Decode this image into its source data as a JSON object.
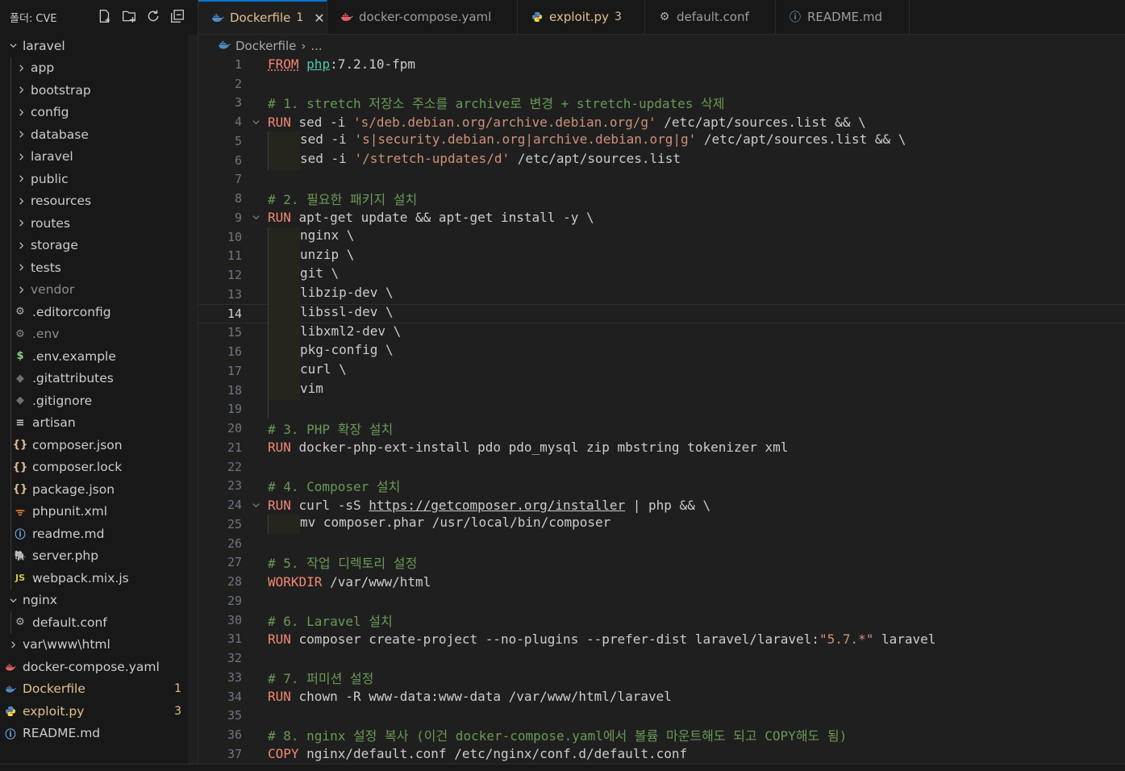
{
  "sidebar": {
    "title": "폴더: CVE",
    "actions": [
      {
        "name": "new-file-icon"
      },
      {
        "name": "new-folder-icon"
      },
      {
        "name": "refresh-icon"
      },
      {
        "name": "collapse-all-icon"
      }
    ],
    "items": [
      {
        "label": "laravel",
        "kind": "folder-open",
        "level": 0
      },
      {
        "label": "app",
        "kind": "folder",
        "level": 1
      },
      {
        "label": "bootstrap",
        "kind": "folder",
        "level": 1
      },
      {
        "label": "config",
        "kind": "folder",
        "level": 1
      },
      {
        "label": "database",
        "kind": "folder",
        "level": 1
      },
      {
        "label": "laravel",
        "kind": "folder",
        "level": 1
      },
      {
        "label": "public",
        "kind": "folder",
        "level": 1
      },
      {
        "label": "resources",
        "kind": "folder",
        "level": 1
      },
      {
        "label": "routes",
        "kind": "folder",
        "level": 1
      },
      {
        "label": "storage",
        "kind": "folder",
        "level": 1
      },
      {
        "label": "tests",
        "kind": "folder",
        "level": 1
      },
      {
        "label": "vendor",
        "kind": "folder",
        "level": 1,
        "dim": true
      },
      {
        "label": ".editorconfig",
        "kind": "file",
        "level": 1,
        "icon": "gear-icon",
        "glyph": "⚙",
        "color": "#b0b0b0"
      },
      {
        "label": ".env",
        "kind": "file",
        "level": 1,
        "icon": "gear-icon",
        "glyph": "⚙",
        "color": "#8c8c8c",
        "dim": true
      },
      {
        "label": ".env.example",
        "kind": "file",
        "level": 1,
        "icon": "dollar-icon",
        "glyph": "$",
        "color": "#89d185"
      },
      {
        "label": ".gitattributes",
        "kind": "file",
        "level": 1,
        "icon": "git-icon",
        "glyph": "◆",
        "color": "#6e6e6e"
      },
      {
        "label": ".gitignore",
        "kind": "file",
        "level": 1,
        "icon": "git-icon",
        "glyph": "◆",
        "color": "#6e6e6e"
      },
      {
        "label": "artisan",
        "kind": "file",
        "level": 1,
        "icon": "lines-icon",
        "glyph": "≡",
        "color": "#cccccc"
      },
      {
        "label": "composer.json",
        "kind": "file",
        "level": 1,
        "icon": "json-braces-icon",
        "glyph": "{}",
        "color": "#e2c08d"
      },
      {
        "label": "composer.lock",
        "kind": "file",
        "level": 1,
        "icon": "json-braces-icon",
        "glyph": "{}",
        "color": "#e2c08d"
      },
      {
        "label": "package.json",
        "kind": "file",
        "level": 1,
        "icon": "json-braces-icon",
        "glyph": "{}",
        "color": "#e2c08d"
      },
      {
        "label": "phpunit.xml",
        "kind": "file",
        "level": 1,
        "icon": "rss-icon",
        "glyph": "ᯤ",
        "color": "#e37933"
      },
      {
        "label": "readme.md",
        "kind": "file",
        "level": 1,
        "icon": "info-icon",
        "glyph": "ⓘ",
        "color": "#75beff"
      },
      {
        "label": "server.php",
        "kind": "file",
        "level": 1,
        "icon": "php-elephant-icon",
        "glyph": "🐘",
        "color": "#a074c4"
      },
      {
        "label": "webpack.mix.js",
        "kind": "file",
        "level": 1,
        "icon": "js-icon",
        "glyph": "JS",
        "color": "#cbcb41"
      },
      {
        "label": "nginx",
        "kind": "folder-open",
        "level": 0
      },
      {
        "label": "default.conf",
        "kind": "file",
        "level": 1,
        "icon": "gear-icon",
        "glyph": "⚙",
        "color": "#b0b0b0"
      },
      {
        "label": "var\\www\\html",
        "kind": "folder",
        "level": 0
      },
      {
        "label": "docker-compose.yaml",
        "kind": "file",
        "level": 0,
        "icon": "docker-compose-icon",
        "glyph": "🐳",
        "color": "#e25f6a"
      },
      {
        "label": "Dockerfile",
        "kind": "file",
        "level": 0,
        "icon": "docker-icon",
        "glyph": "🐳",
        "color": "#4f8cc9",
        "modified": true,
        "badge": "1"
      },
      {
        "label": "exploit.py",
        "kind": "file",
        "level": 0,
        "icon": "python-icon",
        "glyph": "🐍",
        "color": "#4f8cc9",
        "modified": true,
        "badge": "3"
      },
      {
        "label": "README.md",
        "kind": "file",
        "level": 0,
        "icon": "info-icon",
        "glyph": "ⓘ",
        "color": "#75beff"
      }
    ]
  },
  "tabs": [
    {
      "label": "Dockerfile",
      "count": "1",
      "icon": "docker-icon",
      "color": "#4f8cc9",
      "active": true,
      "close": "✕"
    },
    {
      "label": "docker-compose.yaml",
      "count": "",
      "icon": "docker-compose-icon",
      "color": "#e25f6a",
      "active": false
    },
    {
      "label": "exploit.py",
      "count": "3",
      "icon": "python-icon",
      "color": "#4f8cc9",
      "active": false,
      "modified": true
    },
    {
      "label": "default.conf",
      "count": "",
      "icon": "gear-icon",
      "color": "#b0b0b0",
      "active": false
    },
    {
      "label": "README.md",
      "count": "",
      "icon": "info-icon",
      "color": "#75beff",
      "active": false
    }
  ],
  "breadcrumb": {
    "file": "Dockerfile",
    "rest": "..."
  },
  "editor": {
    "current_line": 14,
    "lines": [
      {
        "n": 1,
        "t": [
          {
            "c": "from",
            "s": "FROM"
          },
          {
            "s": " "
          },
          {
            "c": "img",
            "s": "php"
          },
          {
            "s": ":7.2.10-fpm"
          }
        ]
      },
      {
        "n": 2,
        "t": []
      },
      {
        "n": 3,
        "t": [
          {
            "c": "cmt",
            "s": "# 1. stretch 저장소 주소를 archive로 변경 + stretch-updates 삭제"
          }
        ]
      },
      {
        "n": 4,
        "fold": true,
        "t": [
          {
            "c": "dkw",
            "s": "RUN"
          },
          {
            "s": " sed -i "
          },
          {
            "c": "str",
            "s": "'s/deb.debian.org/archive.debian.org/g'"
          },
          {
            "s": " /etc/apt/sources.list && \\"
          }
        ]
      },
      {
        "n": 5,
        "ind": 1,
        "t": [
          {
            "s": "sed -i "
          },
          {
            "c": "str",
            "s": "'s|security.debian.org|archive.debian.org|g'"
          },
          {
            "s": " /etc/apt/sources.list && \\"
          }
        ]
      },
      {
        "n": 6,
        "ind": 1,
        "t": [
          {
            "s": "sed -i "
          },
          {
            "c": "str",
            "s": "'/stretch-updates/d'"
          },
          {
            "s": " /etc/apt/sources.list"
          }
        ]
      },
      {
        "n": 7,
        "t": []
      },
      {
        "n": 8,
        "t": [
          {
            "c": "cmt",
            "s": "# 2. 필요한 패키지 설치"
          }
        ]
      },
      {
        "n": 9,
        "fold": true,
        "t": [
          {
            "c": "dkw",
            "s": "RUN"
          },
          {
            "s": " apt-get update && apt-get install -y \\"
          }
        ]
      },
      {
        "n": 10,
        "ind": 1,
        "t": [
          {
            "s": "nginx \\"
          }
        ]
      },
      {
        "n": 11,
        "ind": 1,
        "t": [
          {
            "s": "unzip \\"
          }
        ]
      },
      {
        "n": 12,
        "ind": 1,
        "t": [
          {
            "s": "git \\"
          }
        ]
      },
      {
        "n": 13,
        "ind": 1,
        "t": [
          {
            "s": "libzip-dev \\"
          }
        ]
      },
      {
        "n": 14,
        "ind": 1,
        "t": [
          {
            "s": "libssl-dev \\"
          }
        ]
      },
      {
        "n": 15,
        "ind": 1,
        "t": [
          {
            "s": "libxml2-dev \\"
          }
        ]
      },
      {
        "n": 16,
        "ind": 1,
        "t": [
          {
            "s": "pkg-config \\"
          }
        ]
      },
      {
        "n": 17,
        "ind": 1,
        "t": [
          {
            "s": "curl \\"
          }
        ]
      },
      {
        "n": 18,
        "ind": 1,
        "t": [
          {
            "s": "vim"
          }
        ]
      },
      {
        "n": 19,
        "guide": true,
        "t": []
      },
      {
        "n": 20,
        "t": [
          {
            "c": "cmt",
            "s": "# 3. PHP 확장 설치"
          }
        ]
      },
      {
        "n": 21,
        "t": [
          {
            "c": "dkw",
            "s": "RUN"
          },
          {
            "s": " docker-php-ext-install pdo pdo_mysql zip mbstring tokenizer xml"
          }
        ]
      },
      {
        "n": 22,
        "t": []
      },
      {
        "n": 23,
        "t": [
          {
            "c": "cmt",
            "s": "# 4. Composer 설치"
          }
        ]
      },
      {
        "n": 24,
        "fold": true,
        "t": [
          {
            "c": "dkw",
            "s": "RUN"
          },
          {
            "s": " curl -sS "
          },
          {
            "c": "link",
            "s": "https://getcomposer.org/installer"
          },
          {
            "s": " | php && \\"
          }
        ]
      },
      {
        "n": 25,
        "ind": 1,
        "t": [
          {
            "s": "mv composer.phar /usr/local/bin/composer"
          }
        ]
      },
      {
        "n": 26,
        "t": []
      },
      {
        "n": 27,
        "t": [
          {
            "c": "cmt",
            "s": "# 5. 작업 디렉토리 설정"
          }
        ]
      },
      {
        "n": 28,
        "t": [
          {
            "c": "dkw",
            "s": "WORKDIR"
          },
          {
            "s": " /var/www/html"
          }
        ]
      },
      {
        "n": 29,
        "t": []
      },
      {
        "n": 30,
        "t": [
          {
            "c": "cmt",
            "s": "# 6. Laravel 설치"
          }
        ]
      },
      {
        "n": 31,
        "t": [
          {
            "c": "dkw",
            "s": "RUN"
          },
          {
            "s": " composer create-project --no-plugins --prefer-dist laravel/laravel:"
          },
          {
            "c": "str",
            "s": "\"5.7.*\""
          },
          {
            "s": " laravel"
          }
        ]
      },
      {
        "n": 32,
        "t": []
      },
      {
        "n": 33,
        "t": [
          {
            "c": "cmt",
            "s": "# 7. 퍼미션 설정"
          }
        ]
      },
      {
        "n": 34,
        "t": [
          {
            "c": "dkw",
            "s": "RUN"
          },
          {
            "s": " chown -R www-data:www-data /var/www/html/laravel"
          }
        ]
      },
      {
        "n": 35,
        "t": []
      },
      {
        "n": 36,
        "t": [
          {
            "c": "cmt",
            "s": "# 8. nginx 설정 복사 (이건 docker-compose.yaml에서 볼륨 마운트해도 되고 COPY해도 됨)"
          }
        ]
      },
      {
        "n": 37,
        "t": [
          {
            "c": "dkw",
            "s": "COPY"
          },
          {
            "s": " nginx/default.conf /etc/nginx/conf.d/default.conf"
          }
        ]
      }
    ]
  }
}
